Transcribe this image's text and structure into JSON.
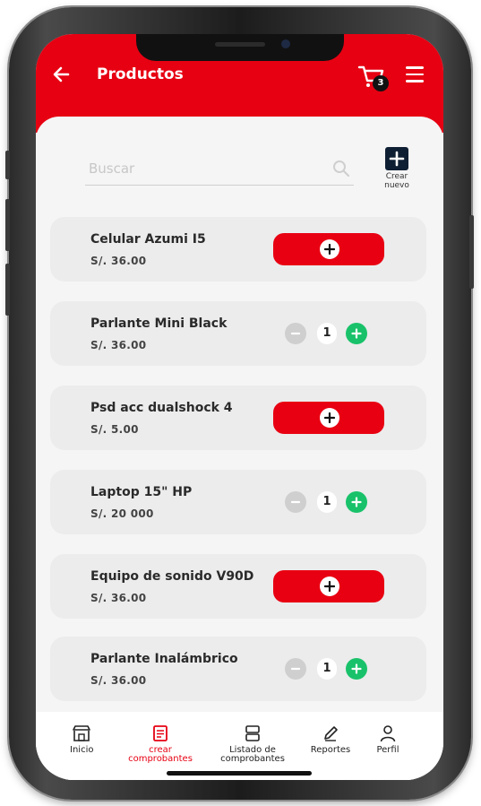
{
  "header": {
    "title": "Productos",
    "cart_count": "3"
  },
  "search": {
    "placeholder": "Buscar",
    "value": ""
  },
  "create_new": {
    "label_line1": "Crear",
    "label_line2": "nuevo"
  },
  "products": [
    {
      "name": "Celular Azumi I5",
      "price": "S/. 36.00",
      "control": "add"
    },
    {
      "name": "Parlante Mini Black",
      "price": "S/. 36.00",
      "control": "stepper",
      "quantity": "1"
    },
    {
      "name": "Psd acc dualshock 4",
      "price": "S/. 5.00",
      "control": "add"
    },
    {
      "name": "Laptop 15\" HP",
      "price": "S/. 20 000",
      "control": "stepper",
      "quantity": "1"
    },
    {
      "name": "Equipo de sonido V90D",
      "price": "S/. 36.00",
      "control": "add"
    },
    {
      "name": "Parlante Inalámbrico",
      "price": "S/. 36.00",
      "control": "stepper",
      "quantity": "1"
    }
  ],
  "bottom_nav": {
    "items": [
      {
        "label_line1": "Inicio",
        "label_line2": "",
        "icon": "store-icon"
      },
      {
        "label_line1": "crear",
        "label_line2": "comprobantes",
        "icon": "receipt-icon",
        "active": true
      },
      {
        "label_line1": "Listado de",
        "label_line2": "comprobantes",
        "icon": "list-icon"
      },
      {
        "label_line1": "Reportes",
        "label_line2": "",
        "icon": "pencil-icon"
      },
      {
        "label_line1": "Perfil",
        "label_line2": "",
        "icon": "user-icon"
      }
    ]
  },
  "colors": {
    "brand_red": "#e60012",
    "add_green": "#19c26a",
    "dark_navy": "#0f1f33"
  }
}
